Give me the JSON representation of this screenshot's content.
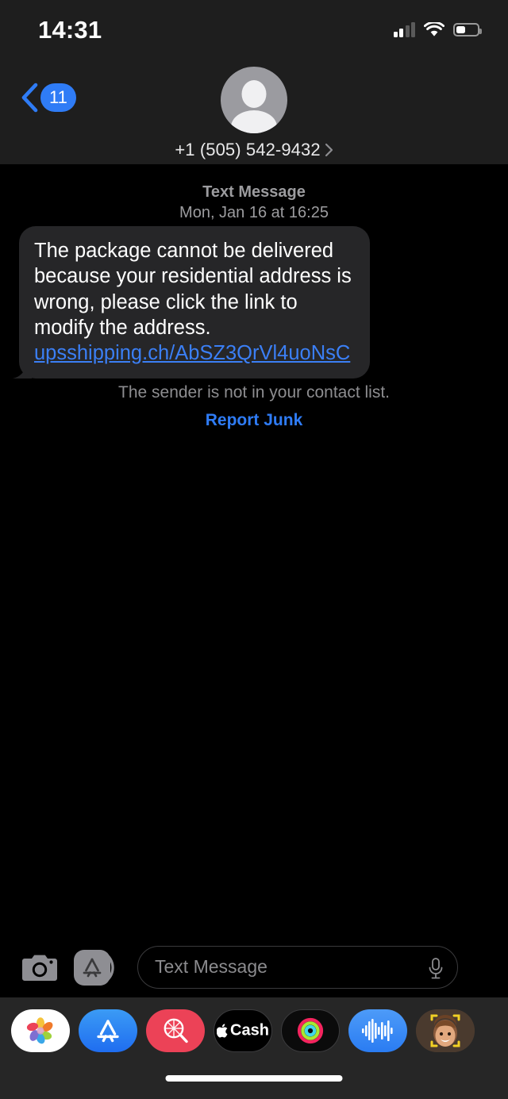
{
  "status_bar": {
    "time": "14:31",
    "cellular_bars_filled": 2,
    "cellular_bars_total": 4,
    "wifi": "wifi-icon",
    "battery_percent": 40
  },
  "nav_bar": {
    "back_badge": "11",
    "back_icon": "chevron-left-icon",
    "avatar": "default-contact-avatar",
    "contact_name": "+1 (505) 542-9432",
    "contact_chevron": "chevron-right-icon"
  },
  "conversation": {
    "message_kind": "Text Message",
    "timestamp": "Mon, Jan 16 at 16:25",
    "message": {
      "body_before_link": "The package cannot be delivered because your residential address is wrong, please click the link to modify the address. ",
      "link_text": "upsshipping.ch/AbSZ3QrVl4uoNsC",
      "sender": "incoming"
    },
    "disclaimer": "The sender is not in your contact list.",
    "report_junk_label": "Report Junk"
  },
  "input_bar": {
    "camera_icon": "camera-icon",
    "appstore_icon": "app-store-icon",
    "placeholder": "Text Message",
    "value": "",
    "mic_icon": "microphone-icon"
  },
  "app_drawer": {
    "apps": [
      {
        "name": "photos",
        "label": "Photos"
      },
      {
        "name": "app-store",
        "label": "App Store"
      },
      {
        "name": "images",
        "label": "#images"
      },
      {
        "name": "apple-cash",
        "label": "Cash"
      },
      {
        "name": "fitness",
        "label": "Fitness"
      },
      {
        "name": "music",
        "label": "Music"
      },
      {
        "name": "memoji",
        "label": "Memoji"
      }
    ]
  },
  "colors": {
    "accent_blue": "#2f7cf6",
    "link_blue": "#3b7ff5",
    "bubble_gray": "#262628",
    "chrome_gray": "#1e1e1e",
    "drawer_gray": "#262626"
  },
  "home_indicator": "home-indicator"
}
